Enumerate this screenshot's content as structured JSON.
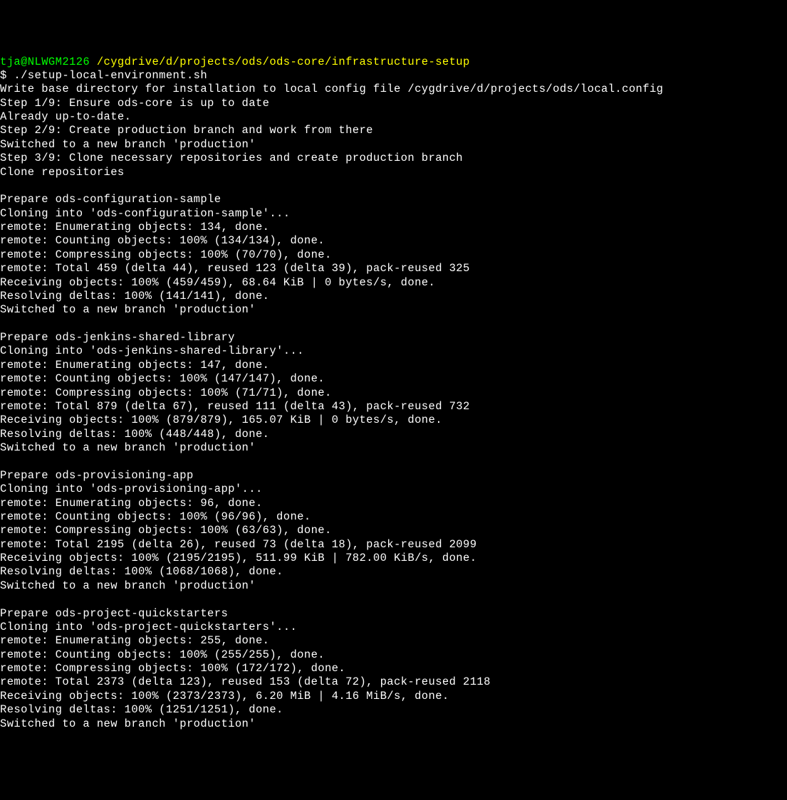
{
  "prompt": {
    "user": "tja@NLWGM2126",
    "path": "/cygdrive/d/projects/ods/ods-core/infrastructure-setup",
    "command": "./setup-local-environment.sh"
  },
  "lines": [
    "Write base directory for installation to local config file /cygdrive/d/projects/ods/local.config",
    "Step 1/9: Ensure ods-core is up to date",
    "Already up-to-date.",
    "Step 2/9: Create production branch and work from there",
    "Switched to a new branch 'production'",
    "Step 3/9: Clone necessary repositories and create production branch",
    "Clone repositories",
    "",
    "Prepare ods-configuration-sample",
    "Cloning into 'ods-configuration-sample'...",
    "remote: Enumerating objects: 134, done.",
    "remote: Counting objects: 100% (134/134), done.",
    "remote: Compressing objects: 100% (70/70), done.",
    "remote: Total 459 (delta 44), reused 123 (delta 39), pack-reused 325",
    "Receiving objects: 100% (459/459), 68.64 KiB | 0 bytes/s, done.",
    "Resolving deltas: 100% (141/141), done.",
    "Switched to a new branch 'production'",
    "",
    "Prepare ods-jenkins-shared-library",
    "Cloning into 'ods-jenkins-shared-library'...",
    "remote: Enumerating objects: 147, done.",
    "remote: Counting objects: 100% (147/147), done.",
    "remote: Compressing objects: 100% (71/71), done.",
    "remote: Total 879 (delta 67), reused 111 (delta 43), pack-reused 732",
    "Receiving objects: 100% (879/879), 165.07 KiB | 0 bytes/s, done.",
    "Resolving deltas: 100% (448/448), done.",
    "Switched to a new branch 'production'",
    "",
    "Prepare ods-provisioning-app",
    "Cloning into 'ods-provisioning-app'...",
    "remote: Enumerating objects: 96, done.",
    "remote: Counting objects: 100% (96/96), done.",
    "remote: Compressing objects: 100% (63/63), done.",
    "remote: Total 2195 (delta 26), reused 73 (delta 18), pack-reused 2099",
    "Receiving objects: 100% (2195/2195), 511.99 KiB | 782.00 KiB/s, done.",
    "Resolving deltas: 100% (1068/1068), done.",
    "Switched to a new branch 'production'",
    "",
    "Prepare ods-project-quickstarters",
    "Cloning into 'ods-project-quickstarters'...",
    "remote: Enumerating objects: 255, done.",
    "remote: Counting objects: 100% (255/255), done.",
    "remote: Compressing objects: 100% (172/172), done.",
    "remote: Total 2373 (delta 123), reused 153 (delta 72), pack-reused 2118",
    "Receiving objects: 100% (2373/2373), 6.20 MiB | 4.16 MiB/s, done.",
    "Resolving deltas: 100% (1251/1251), done.",
    "Switched to a new branch 'production'"
  ]
}
